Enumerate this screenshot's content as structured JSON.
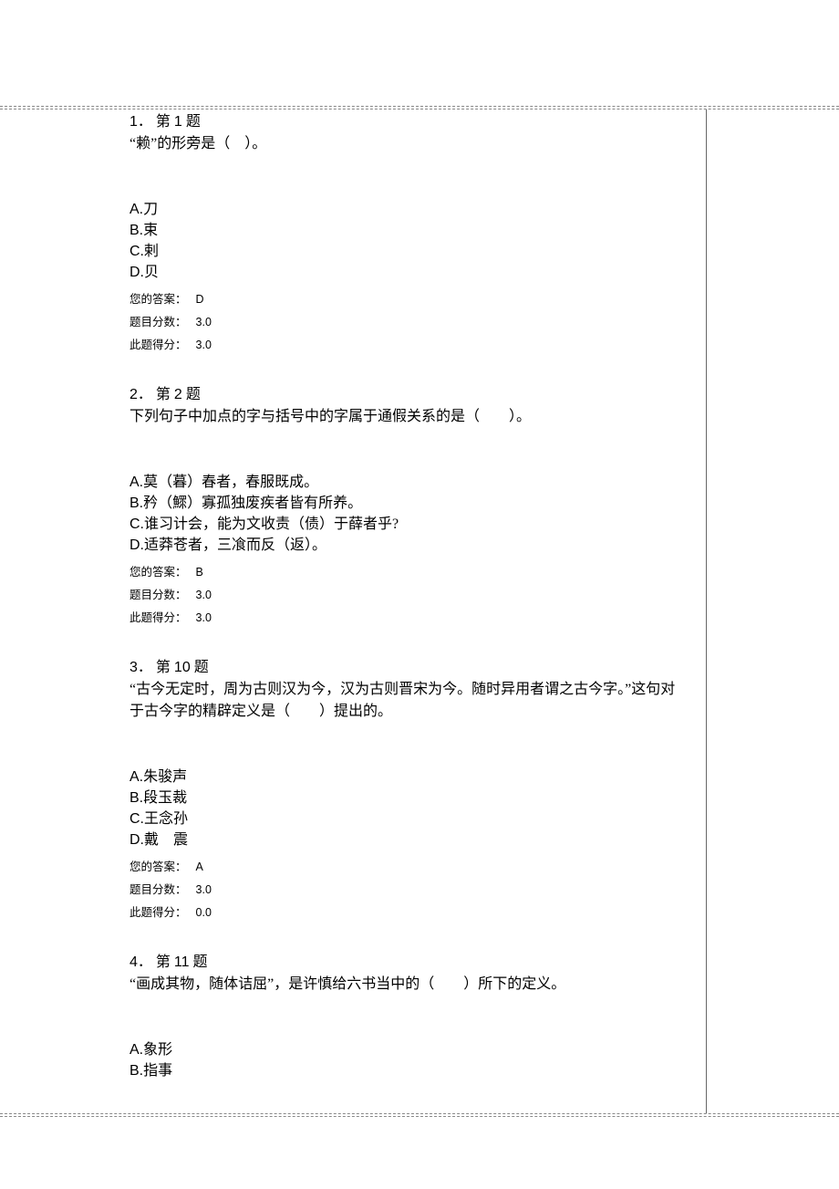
{
  "labels": {
    "question_prefix": "第",
    "question_suffix": "题",
    "your_answer": "您的答案：",
    "question_score": "题目分数：",
    "this_score": "此题得分："
  },
  "questions": [
    {
      "index": "1．",
      "number": "1",
      "text": "“赖”的形旁是（　）。",
      "options": [
        {
          "letter": "A.",
          "text": "刀"
        },
        {
          "letter": "B.",
          "text": "束"
        },
        {
          "letter": "C.",
          "text": "剌"
        },
        {
          "letter": "D.",
          "text": "贝"
        }
      ],
      "answer": "D",
      "score": "3.0",
      "got": "3.0"
    },
    {
      "index": "2．",
      "number": "2",
      "text": "下列句子中加点的字与括号中的字属于通假关系的是（　　）。",
      "options": [
        {
          "letter": "A.",
          "text": "莫（暮）春者，春服既成。"
        },
        {
          "letter": "B.",
          "text": "矜（鰥）寡孤独废疾者皆有所养。"
        },
        {
          "letter": "C.",
          "text": "谁习计会，能为文收责（债）于薛者乎?"
        },
        {
          "letter": "D.",
          "text": "适莽苍者，三飡而反（返）。"
        }
      ],
      "answer": "B",
      "score": "3.0",
      "got": "3.0"
    },
    {
      "index": "3．",
      "number": "10",
      "text": "“古今无定时，周为古则汉为今，汉为古则晋宋为今。随时异用者谓之古今字。”这句对于古今字的精辟定义是（　　）提出的。",
      "options": [
        {
          "letter": "A.",
          "text": "朱骏声"
        },
        {
          "letter": "B.",
          "text": "段玉裁"
        },
        {
          "letter": "C.",
          "text": "王念孙"
        },
        {
          "letter": "D.",
          "text": "戴　震"
        }
      ],
      "answer": "A",
      "score": "3.0",
      "got": "0.0"
    },
    {
      "index": "4．",
      "number": "11",
      "text": "“画成其物，随体诘屈”，是许慎给六书当中的（　　）所下的定义。",
      "options": [
        {
          "letter": "A.",
          "text": "象形"
        },
        {
          "letter": "B.",
          "text": "指事"
        }
      ],
      "answer": null,
      "score": null,
      "got": null
    }
  ]
}
